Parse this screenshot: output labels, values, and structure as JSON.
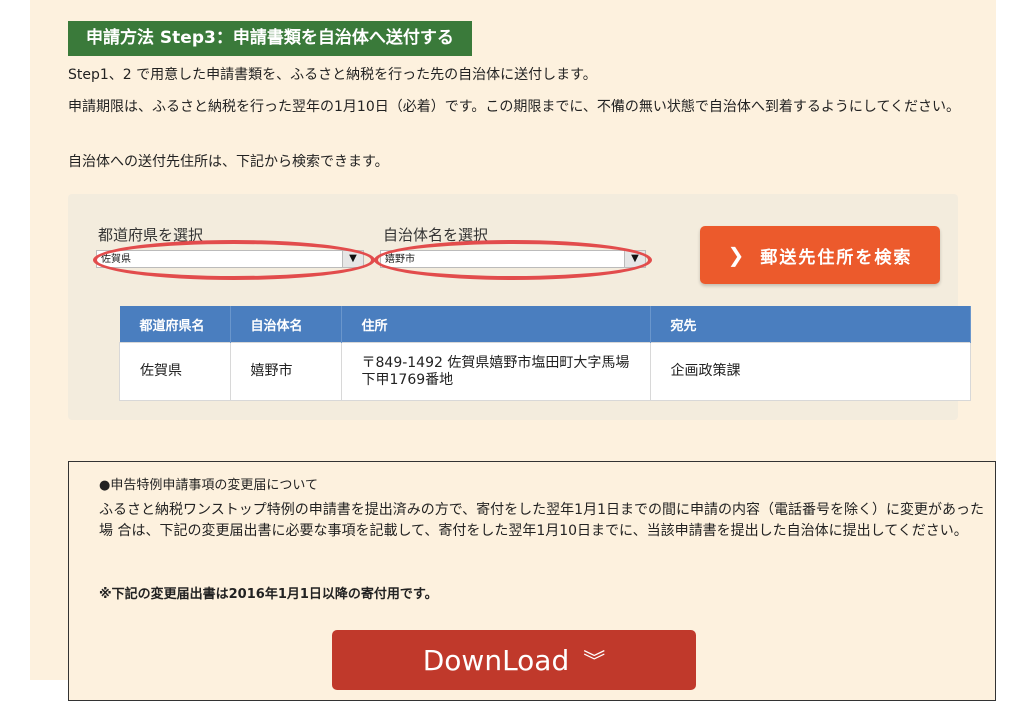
{
  "step_title": "申請方法 Step3：申請書類を自治体へ送付する",
  "paragraphs": {
    "p1": "Step1、2 で用意した申請書類を、ふるさと納税を行った先の自治体に送付します。",
    "p2": "申請期限は、ふるさと納税を行った翌年の1月10日（必着）です。この期限までに、不備の無い状態で自治体へ到着するようにしてください。",
    "p3": "自治体への送付先住所は、下記から検索できます。"
  },
  "search": {
    "prefecture_label": "都道府県を選択",
    "prefecture_value": "佐賀県",
    "municipality_label": "自治体名を選択",
    "municipality_value": "嬉野市",
    "button_label": "郵送先住所を検索"
  },
  "table": {
    "headers": [
      "都道府県名",
      "自治体名",
      "住所",
      "宛先"
    ],
    "rows": [
      [
        "佐賀県",
        "嬉野市",
        "〒849-1492 佐賀県嬉野市塩田町大字馬場下甲1769番地",
        "企画政策課"
      ]
    ]
  },
  "notice": {
    "title": "●申告特例申請事項の変更届について",
    "text": "ふるさと納税ワンストップ特例の申請書を提出済みの方で、寄付をした翌年1月1日までの間に申請の内容（電話番号を除く）に変更があった場 合は、下記の変更届出書に必要な事項を記載して、寄付をした翌年1月10日までに、当該申請書を提出した自治体に提出してください。",
    "bold": "※下記の変更届出書は2016年1月1日以降の寄付用です。",
    "download_label": "DownLoad"
  },
  "colors": {
    "title_bg": "#3a7a3a",
    "page_bg": "#fdf1de",
    "button_orange": "#ec5a2c",
    "table_header": "#4a7ebf",
    "download_red": "#c0392b",
    "highlight_ellipse": "#e24c4c"
  },
  "icons": {
    "select_arrow": "triangle-down-icon",
    "search_chevron": "chevron-right-icon",
    "download_chevron": "double-chevron-down-icon"
  }
}
